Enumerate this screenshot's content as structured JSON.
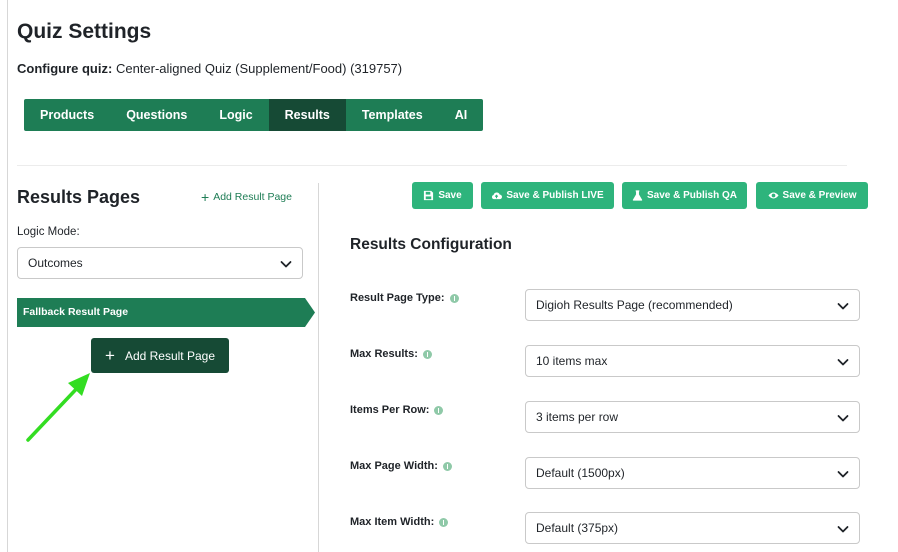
{
  "header": {
    "title": "Quiz Settings",
    "configure_label": "Configure quiz:",
    "configure_value": "Center-aligned Quiz (Supplement/Food) (319757)"
  },
  "tabs": [
    {
      "label": "Products",
      "active": false
    },
    {
      "label": "Questions",
      "active": false
    },
    {
      "label": "Logic",
      "active": false
    },
    {
      "label": "Results",
      "active": true
    },
    {
      "label": "Templates",
      "active": false
    },
    {
      "label": "AI",
      "active": false
    }
  ],
  "sidebar": {
    "title": "Results Pages",
    "add_link_label": "Add Result Page",
    "logic_mode_label": "Logic Mode:",
    "logic_mode_value": "Outcomes",
    "fallback_label": "Fallback Result Page",
    "add_button_label": "Add Result Page"
  },
  "actions": {
    "save": "Save",
    "save_publish_live": "Save & Publish LIVE",
    "save_publish_qa": "Save & Publish QA",
    "save_preview": "Save & Preview"
  },
  "config": {
    "title": "Results Configuration",
    "fields": [
      {
        "label": "Result Page Type:",
        "value": "Digioh Results Page (recommended)"
      },
      {
        "label": "Max Results:",
        "value": "10 items max"
      },
      {
        "label": "Items Per Row:",
        "value": "3 items per row"
      },
      {
        "label": "Max Page Width:",
        "value": "Default (1500px)"
      },
      {
        "label": "Max Item Width:",
        "value": "Default (375px)"
      }
    ]
  },
  "colors": {
    "primary_green": "#1e7d55",
    "dark_green": "#164a35",
    "button_green": "#2eb47c",
    "annotation_arrow": "#33dd22"
  }
}
